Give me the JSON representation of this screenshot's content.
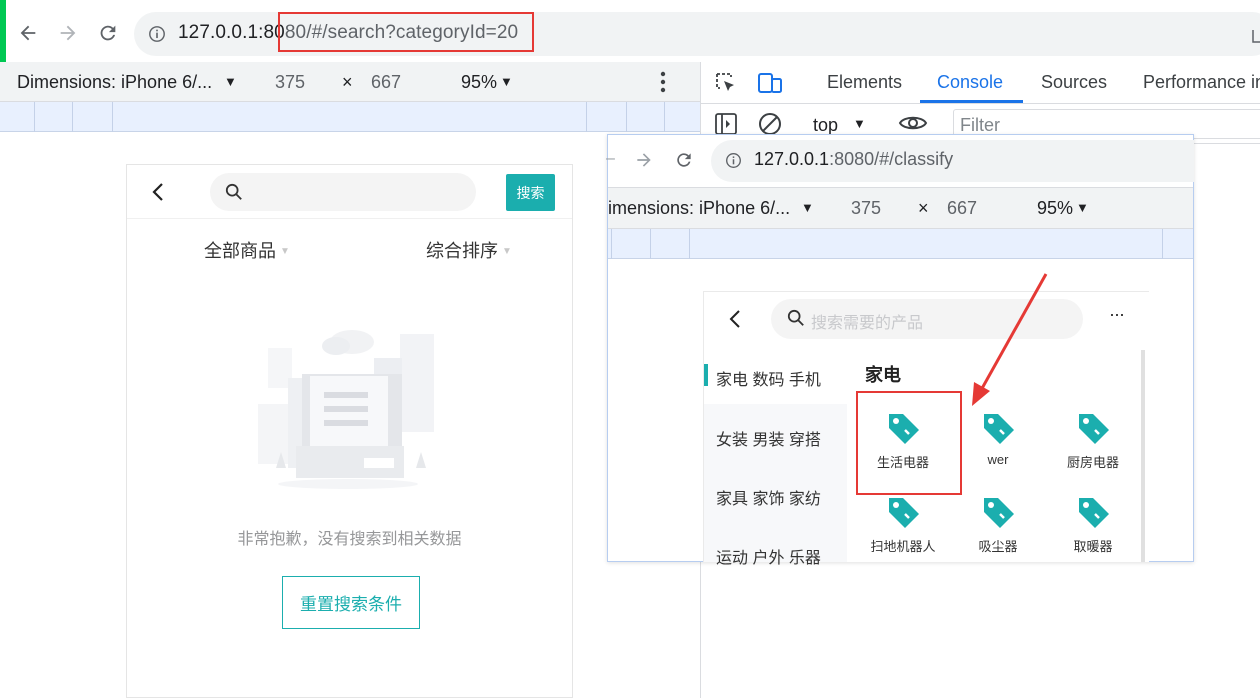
{
  "browser": {
    "url_prefix": "127.0.0.1:80",
    "url_suffix": "80/#/search?categoryId=20",
    "url_host_dim": ":8080"
  },
  "device_toolbar": {
    "device": "Dimensions: iPhone 6/...",
    "width": "375",
    "times": "×",
    "height": "667",
    "zoom": "95%"
  },
  "devtools": {
    "tabs": [
      "Elements",
      "Console",
      "Sources",
      "Performance in"
    ],
    "active_tab": "Console",
    "context": "top",
    "filter_placeholder": "Filter"
  },
  "search_page": {
    "search_button": "搜索",
    "filters": [
      "全部商品",
      "综合排序"
    ],
    "empty_text": "非常抱歉，没有搜索到相关数据",
    "reset_button": "重置搜索条件"
  },
  "popup": {
    "url_host": "127.0.0.1",
    "url_rest": ":8080/#/classify",
    "device": "imensions: iPhone 6/...",
    "width": "375",
    "times": "×",
    "height": "667",
    "zoom": "95%",
    "search_placeholder": "搜索需要的产品",
    "more": "···",
    "sidebar": [
      "家电 数码 手机",
      "女装 男装 穿搭",
      "家具 家饰 家纺",
      "运动 户外 乐器"
    ],
    "category_title": "家电",
    "items": [
      "生活电器",
      "wer",
      "厨房电器",
      "扫地机器人",
      "吸尘器",
      "取暖器"
    ]
  },
  "colors": {
    "accent": "#1baeae",
    "highlight": "#e53935",
    "devtools_blue": "#1a73e8"
  }
}
